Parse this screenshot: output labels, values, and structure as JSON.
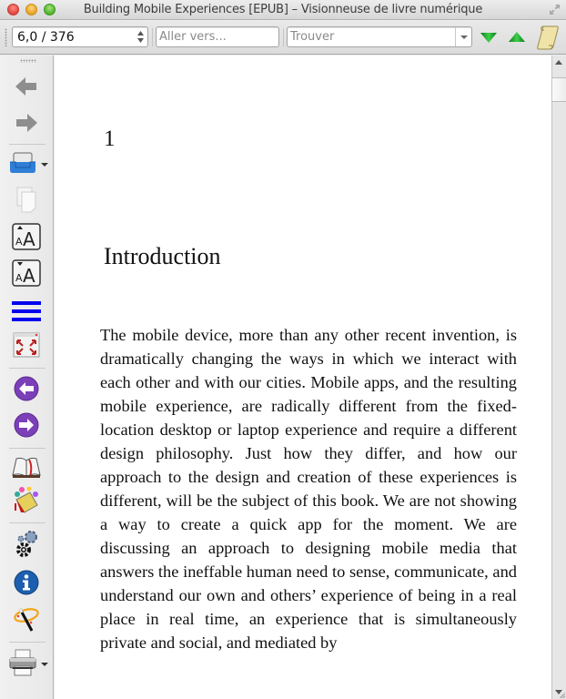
{
  "window": {
    "title": "Building Mobile Experiences [EPUB] – Visionneuse de livre numérique",
    "controls": [
      "close",
      "minimize",
      "maximize"
    ]
  },
  "toolbar": {
    "page_position": "6,0 / 376",
    "goto_placeholder": "Aller vers...",
    "search_placeholder": "Trouver",
    "find_next_icon": "green-down-triangle-icon",
    "find_previous_icon": "green-up-triangle-icon",
    "reference_mode_icon": "scroll-icon",
    "colors": {
      "find_arrows": "#1e9e2a"
    }
  },
  "sidebar": {
    "items": [
      {
        "name": "back",
        "icon": "left-arrow-icon"
      },
      {
        "name": "forward",
        "icon": "right-arrow-icon"
      },
      {
        "name": "open-ebook",
        "icon": "open-folder-icon",
        "has_dropdown": true
      },
      {
        "name": "copy",
        "icon": "copy-icon"
      },
      {
        "name": "font-size-larger",
        "icon": "font-larger-icon"
      },
      {
        "name": "font-size-smaller",
        "icon": "font-smaller-icon"
      },
      {
        "name": "table-of-contents",
        "icon": "toc-lines-icon"
      },
      {
        "name": "fullscreen",
        "icon": "fullscreen-icon"
      },
      {
        "name": "previous-page",
        "icon": "purple-left-circle-icon"
      },
      {
        "name": "next-page",
        "icon": "purple-right-circle-icon"
      },
      {
        "name": "bookmarks",
        "icon": "book-bookmark-icon"
      },
      {
        "name": "theme",
        "icon": "paint-bucket-icon"
      },
      {
        "name": "preferences",
        "icon": "gears-icon"
      },
      {
        "name": "metadata",
        "icon": "info-icon"
      },
      {
        "name": "lookup",
        "icon": "magic-wand-icon"
      },
      {
        "name": "print",
        "icon": "printer-icon",
        "has_dropdown": true
      }
    ],
    "colors": {
      "toc_lines": "#0000ee",
      "nav_circles": "#7b3fb8",
      "info": "#1d5fae"
    }
  },
  "content": {
    "chapter_number": "1",
    "chapter_title": "Introduction",
    "paragraph": "The mobile device, more than any other recent invention, is dramatically changing the ways in which we interact with each other and with our cities. Mobile apps, and the resulting mobile experience, are radically different from the fixed-location desktop or laptop experience and require a different design philosophy. Just how they differ, and how our approach to the design and creation of these experiences is different, will be the subject of this book. We are not showing a way to create a quick app for the moment. We are discussing an approach to designing mobile media that answers the ineffable human need to sense, communicate, and understand our own and others’ experience of being in a real place in real time, an experience that is simultaneously private and social, and mediated by"
  },
  "scrollbar": {
    "position_fraction": 0.0
  }
}
